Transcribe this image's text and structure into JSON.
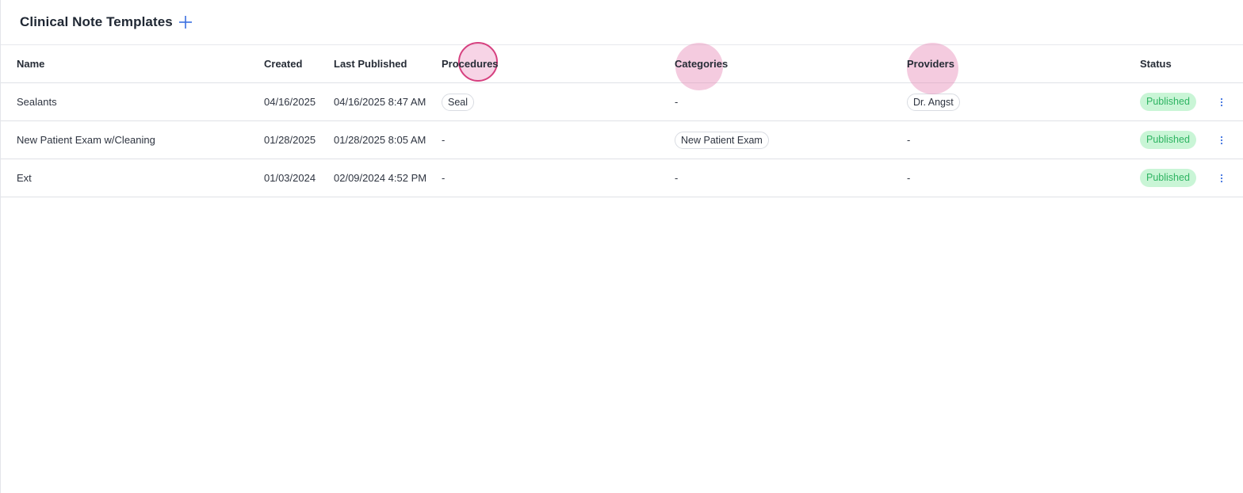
{
  "header": {
    "title": "Clinical Note Templates",
    "add_icon": "plus-icon"
  },
  "table": {
    "columns": {
      "name": "Name",
      "created": "Created",
      "last_published": "Last Published",
      "procedures": "Procedures",
      "categories": "Categories",
      "providers": "Providers",
      "status": "Status"
    },
    "rows": [
      {
        "name": "Sealants",
        "created": "04/16/2025",
        "last_published": "04/16/2025 8:47 AM",
        "procedures": "Seal",
        "categories": "-",
        "providers": "Dr. Angst",
        "status": "Published"
      },
      {
        "name": "New Patient Exam w/Cleaning",
        "created": "01/28/2025",
        "last_published": "01/28/2025 8:05 AM",
        "procedures": "-",
        "categories": "New Patient Exam",
        "providers": "-",
        "status": "Published"
      },
      {
        "name": "Ext",
        "created": "01/03/2024",
        "last_published": "02/09/2024 4:52 PM",
        "procedures": "-",
        "categories": "-",
        "providers": "-",
        "status": "Published"
      }
    ]
  },
  "colors": {
    "accent": "#3b6fe0",
    "status_published_bg": "#c9f5d6",
    "status_published_text": "#2eb462",
    "highlight": "#e68cb9"
  },
  "icons": {
    "row_menu": "kebab-menu-icon"
  }
}
